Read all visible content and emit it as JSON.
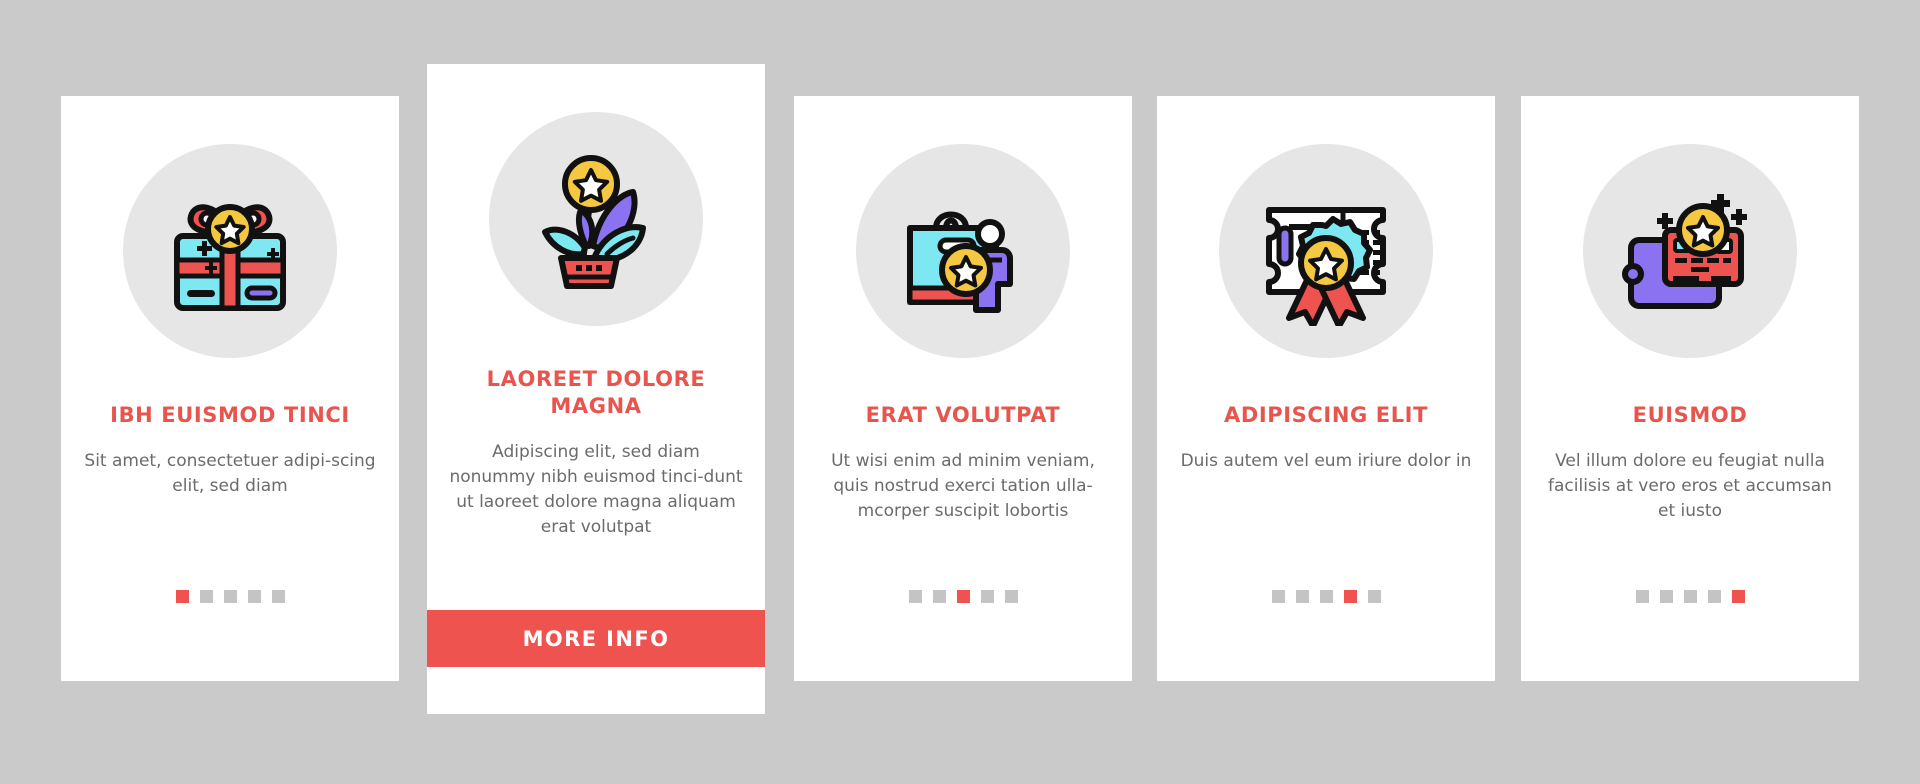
{
  "theme": {
    "background": "#cacaca",
    "card_background": "#ffffff",
    "accent_red": "#ef5350",
    "title_red": "#e8554e",
    "body_text": "#6b6b6b",
    "icon_circle": "#e6e6e6",
    "dot_inactive": "#c4c4c4"
  },
  "cards": [
    {
      "icon": "gift-box-star-icon",
      "title": "IBH EUISMOD TINCI",
      "description": "Sit amet, consectetuer adipi-scing elit, sed diam",
      "pagination": {
        "total": 5,
        "active_index": 0
      },
      "featured": false
    },
    {
      "icon": "plant-pot-star-coin-icon",
      "title": "LAOREET DOLORE MAGNA",
      "description": "Adipiscing elit, sed diam nonummy nibh euismod tinci-dunt ut laoreet dolore magna aliquam erat volutpat",
      "button_label": "MORE INFO",
      "featured": true
    },
    {
      "icon": "shopping-bag-customer-star-icon",
      "title": "ERAT VOLUTPAT",
      "description": "Ut wisi enim ad minim veniam, quis nostrud exerci tation ulla-mcorper suscipit lobortis",
      "pagination": {
        "total": 5,
        "active_index": 2
      },
      "featured": false
    },
    {
      "icon": "certificate-award-ribbon-icon",
      "title": "ADIPISCING ELIT",
      "description": "Duis autem vel eum iriure dolor in",
      "pagination": {
        "total": 5,
        "active_index": 3
      },
      "featured": false
    },
    {
      "icon": "wallet-credit-card-star-icon",
      "title": "EUISMOD",
      "description": "Vel illum dolore eu feugiat nulla facilisis at vero eros et accumsan et iusto",
      "pagination": {
        "total": 5,
        "active_index": 4
      },
      "featured": false
    }
  ]
}
